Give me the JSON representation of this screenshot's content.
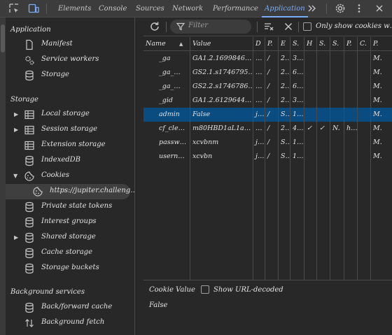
{
  "tabs": [
    {
      "label": "Elements"
    },
    {
      "label": "Console"
    },
    {
      "label": "Sources"
    },
    {
      "label": "Network"
    },
    {
      "label": "Performance"
    },
    {
      "label": "Application"
    }
  ],
  "sidebar": {
    "application_title": "Application",
    "application_items": [
      {
        "label": "Manifest",
        "icon": "document-icon"
      },
      {
        "label": "Service workers",
        "icon": "gears-icon"
      },
      {
        "label": "Storage",
        "icon": "database-icon"
      }
    ],
    "storage_title": "Storage",
    "storage_items": [
      {
        "label": "Local storage",
        "icon": "table-icon"
      },
      {
        "label": "Session storage",
        "icon": "table-icon"
      },
      {
        "label": "Extension storage",
        "icon": "table-icon"
      },
      {
        "label": "IndexedDB",
        "icon": "database-icon"
      },
      {
        "label": "Cookies",
        "icon": "cookie-icon"
      },
      {
        "label": "https://jupiter.challeng…",
        "icon": "cookie-icon"
      },
      {
        "label": "Private state tokens",
        "icon": "database-icon"
      },
      {
        "label": "Interest groups",
        "icon": "database-icon"
      },
      {
        "label": "Shared storage",
        "icon": "database-icon"
      },
      {
        "label": "Cache storage",
        "icon": "database-icon"
      },
      {
        "label": "Storage buckets",
        "icon": "database-icon"
      }
    ],
    "background_title": "Background services",
    "background_items": [
      {
        "label": "Back/forward cache",
        "icon": "database-icon"
      },
      {
        "label": "Background fetch",
        "icon": "sync-arrows-icon"
      }
    ]
  },
  "toolbar": {
    "filter_placeholder": "Filter",
    "only_issues_label": "Only show cookies w…"
  },
  "table": {
    "columns": [
      "Name",
      "Value",
      "D",
      "P.",
      "E",
      "S.",
      "H",
      "S.",
      "S.",
      "P.",
      "C.",
      "P."
    ],
    "rows": [
      [
        "_ga",
        "GA1.2.1699846…",
        "…",
        "/",
        "2…",
        "3…",
        "",
        "",
        "",
        "",
        "",
        "M."
      ],
      [
        "_ga_…",
        "GS2.1.s1746795…",
        "…",
        "/",
        "2…",
        "6…",
        "",
        "",
        "",
        "",
        "",
        "M."
      ],
      [
        "_ga_…",
        "GS2.2.s1746786…",
        "…",
        "/",
        "2…",
        "6…",
        "",
        "",
        "",
        "",
        "",
        "M."
      ],
      [
        "_gid",
        "GA1.2.6129644…",
        "…",
        "/",
        "2…",
        "3…",
        "",
        "",
        "",
        "",
        "",
        "M."
      ],
      [
        "admin",
        "False",
        "j…",
        "/",
        "S…",
        "1…",
        "",
        "",
        "",
        "",
        "",
        "M."
      ],
      [
        "cf_cle…",
        "m80HBD1aL1a…",
        "…",
        "/",
        "2…",
        "4…",
        "✓",
        "✓",
        "N.",
        "h…",
        "",
        "M."
      ],
      [
        "passw…",
        "xcvbnm",
        "j…",
        "/",
        "S…",
        "1…",
        "",
        "",
        "",
        "",
        "",
        "M."
      ],
      [
        "usern…",
        "xcvbn",
        "j…",
        "/",
        "S…",
        "1…",
        "",
        "",
        "",
        "",
        "",
        "M."
      ]
    ],
    "selected_row": 4
  },
  "bottom": {
    "cookie_value_label": "Cookie Value",
    "decode_label": "Show URL-decoded",
    "value": "False"
  },
  "colors": {
    "accent": "#7cacf8",
    "selected_row": "#0a4b80"
  }
}
